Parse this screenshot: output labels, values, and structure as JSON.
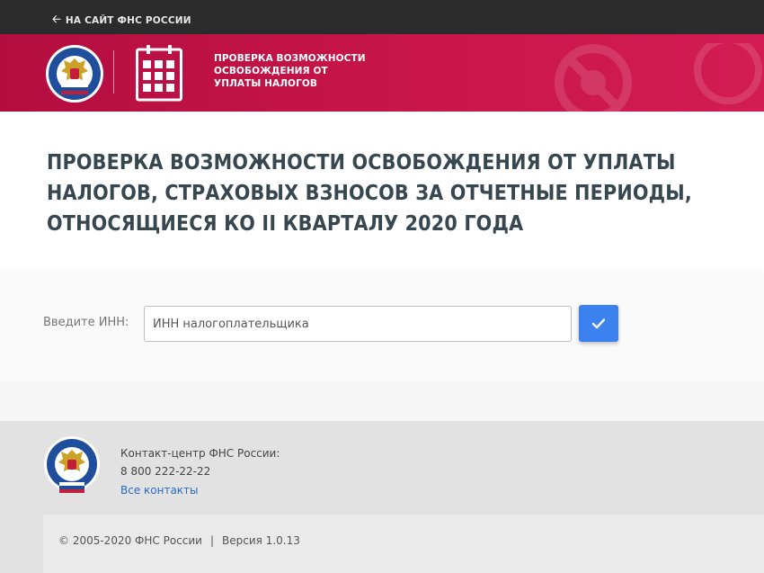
{
  "topbar": {
    "back_link": "НА САЙТ ФНС РОССИИ",
    "back_icon": "arrow-left-icon"
  },
  "banner": {
    "emblem_text": "ФЕДЕРАЛЬНАЯ НАЛОГОВАЯ СЛУЖБА",
    "title_lines": [
      "ПРОВЕРКА ВОЗМОЖНОСТИ",
      "ОСВОБОЖДЕНИЯ ОТ",
      "УПЛАТЫ НАЛОГОВ"
    ]
  },
  "hero": {
    "title_lines": [
      "ПРОВЕРКА ВОЗМОЖНОСТИ ОСВОБОЖДЕНИЯ ОТ УПЛАТЫ",
      "НАЛОГОВ, СТРАХОВЫХ ВЗНОСОВ ЗА ОТЧЕТНЫЕ ПЕРИОДЫ,",
      "ОТНОСЯЩИЕСЯ КО II КВАРТАЛУ 2020 ГОДА"
    ]
  },
  "form": {
    "label": "Введите ИНН:",
    "input_value": "",
    "input_placeholder": "ИНН налогоплательщика",
    "submit_icon": "checkmark-icon"
  },
  "footer": {
    "contact_title": "Контакт-центр ФНС России:",
    "phone": "8 800 222-22-22",
    "contacts_link": "Все контакты",
    "copyright": "© 2005-2020 ФНС России",
    "separator": "|",
    "version": "Версия 1.0.13"
  },
  "colors": {
    "topbar": "#2b2b2b",
    "banner": "#c8164a",
    "title": "#37474f",
    "button": "#3b82f0",
    "link": "#2a6bc4"
  }
}
